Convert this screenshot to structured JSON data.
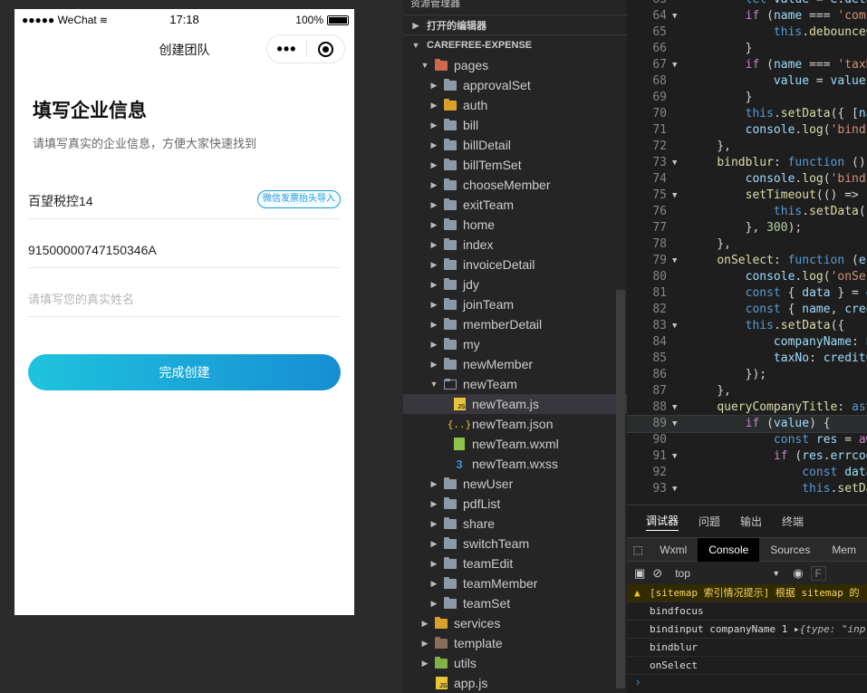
{
  "simulator": {
    "status": {
      "carrier": "●●●●● WeChat",
      "time": "17:18",
      "battery": "100%"
    },
    "nav_title": "创建团队",
    "heading": "填写企业信息",
    "subtitle": "请填写真实的企业信息，方便大家快速找到",
    "company_name": "百望税控14",
    "import_label": "微信发票抬头导入",
    "tax_no": "91500000747150346A",
    "name_placeholder": "请填写您的真实姓名",
    "submit_label": "完成创建"
  },
  "explorer": {
    "top_label": "资源管理器",
    "open_editors": "打开的编辑器",
    "project": "CAREFREE-EXPENSE",
    "tree": [
      {
        "label": "pages",
        "depth": 1,
        "type": "folder-red",
        "open": true
      },
      {
        "label": "approvalSet",
        "depth": 2,
        "type": "folder"
      },
      {
        "label": "auth",
        "depth": 2,
        "type": "folder-gold"
      },
      {
        "label": "bill",
        "depth": 2,
        "type": "folder"
      },
      {
        "label": "billDetail",
        "depth": 2,
        "type": "folder"
      },
      {
        "label": "billTemSet",
        "depth": 2,
        "type": "folder"
      },
      {
        "label": "chooseMember",
        "depth": 2,
        "type": "folder"
      },
      {
        "label": "exitTeam",
        "depth": 2,
        "type": "folder"
      },
      {
        "label": "home",
        "depth": 2,
        "type": "folder"
      },
      {
        "label": "index",
        "depth": 2,
        "type": "folder"
      },
      {
        "label": "invoiceDetail",
        "depth": 2,
        "type": "folder"
      },
      {
        "label": "jdy",
        "depth": 2,
        "type": "folder"
      },
      {
        "label": "joinTeam",
        "depth": 2,
        "type": "folder"
      },
      {
        "label": "memberDetail",
        "depth": 2,
        "type": "folder"
      },
      {
        "label": "my",
        "depth": 2,
        "type": "folder"
      },
      {
        "label": "newMember",
        "depth": 2,
        "type": "folder"
      },
      {
        "label": "newTeam",
        "depth": 2,
        "type": "folder-open",
        "open": true
      },
      {
        "label": "newTeam.js",
        "depth": 3,
        "type": "js",
        "selected": true
      },
      {
        "label": "newTeam.json",
        "depth": 3,
        "type": "json"
      },
      {
        "label": "newTeam.wxml",
        "depth": 3,
        "type": "wxml"
      },
      {
        "label": "newTeam.wxss",
        "depth": 3,
        "type": "wxss"
      },
      {
        "label": "newUser",
        "depth": 2,
        "type": "folder"
      },
      {
        "label": "pdfList",
        "depth": 2,
        "type": "folder"
      },
      {
        "label": "share",
        "depth": 2,
        "type": "folder"
      },
      {
        "label": "switchTeam",
        "depth": 2,
        "type": "folder"
      },
      {
        "label": "teamEdit",
        "depth": 2,
        "type": "folder"
      },
      {
        "label": "teamMember",
        "depth": 2,
        "type": "folder"
      },
      {
        "label": "teamSet",
        "depth": 2,
        "type": "folder"
      },
      {
        "label": "services",
        "depth": 1,
        "type": "folder-gold"
      },
      {
        "label": "template",
        "depth": 1,
        "type": "folder-brown"
      },
      {
        "label": "utils",
        "depth": 1,
        "type": "folder-green"
      },
      {
        "label": "app.js",
        "depth": 1,
        "type": "js"
      }
    ]
  },
  "editor": {
    "lines": [
      {
        "n": "63",
        "fold": "",
        "html": "        <span class='k'>let</span> <span class='v'>value</span> = <span class='v'>e</span>.<span class='v'>deta</span>"
      },
      {
        "n": "64",
        "fold": "v",
        "html": "        <span class='kw'>if</span> (<span class='v'>name</span> === <span class='s'>'comp</span>"
      },
      {
        "n": "65",
        "fold": "",
        "html": "            <span class='k'>this</span>.<span class='f'>debounceC</span>"
      },
      {
        "n": "66",
        "fold": "",
        "html": "        }"
      },
      {
        "n": "67",
        "fold": "v",
        "html": "        <span class='kw'>if</span> (<span class='v'>name</span> === <span class='s'>'taxN</span>"
      },
      {
        "n": "68",
        "fold": "",
        "html": "            <span class='v'>value</span> = <span class='v'>value</span>."
      },
      {
        "n": "69",
        "fold": "",
        "html": "        }"
      },
      {
        "n": "70",
        "fold": "",
        "html": "        <span class='k'>this</span>.<span class='f'>setData</span>({ [<span class='v'>na</span>"
      },
      {
        "n": "71",
        "fold": "",
        "html": "        <span class='v'>console</span>.<span class='f'>log</span>(<span class='s'>'bindi</span>"
      },
      {
        "n": "72",
        "fold": "",
        "html": "    },"
      },
      {
        "n": "73",
        "fold": "v",
        "html": "    <span class='f'>bindblur</span>: <span class='k'>function</span> () {"
      },
      {
        "n": "74",
        "fold": "",
        "html": "        <span class='v'>console</span>.<span class='f'>log</span>(<span class='s'>'bindb</span>"
      },
      {
        "n": "75",
        "fold": "v",
        "html": "        <span class='f'>setTimeout</span>(() => {"
      },
      {
        "n": "76",
        "fold": "",
        "html": "            <span class='k'>this</span>.<span class='f'>setData</span>({"
      },
      {
        "n": "77",
        "fold": "",
        "html": "        }, <span class='n'>300</span>);"
      },
      {
        "n": "78",
        "fold": "",
        "html": "    },"
      },
      {
        "n": "79",
        "fold": "v",
        "html": "    <span class='f'>onSelect</span>: <span class='k'>function</span> (<span class='v'>e</span>)"
      },
      {
        "n": "80",
        "fold": "",
        "html": "        <span class='v'>console</span>.<span class='f'>log</span>(<span class='s'>'onSel</span>"
      },
      {
        "n": "81",
        "fold": "",
        "html": "        <span class='k'>const</span> { <span class='v'>data</span> } = <span class='v'>e</span>"
      },
      {
        "n": "82",
        "fold": "",
        "html": "        <span class='k'>const</span> { <span class='v'>name</span>, <span class='v'>cred</span>"
      },
      {
        "n": "83",
        "fold": "v",
        "html": "        <span class='k'>this</span>.<span class='f'>setData</span>({"
      },
      {
        "n": "84",
        "fold": "",
        "html": "            <span class='v'>companyName</span>: <span class='v'>n</span>"
      },
      {
        "n": "85",
        "fold": "",
        "html": "            <span class='v'>taxNo</span>: <span class='v'>creditC</span>"
      },
      {
        "n": "86",
        "fold": "",
        "html": "        });"
      },
      {
        "n": "87",
        "fold": "",
        "html": "    },"
      },
      {
        "n": "88",
        "fold": "v",
        "html": "    <span class='f'>queryCompanyTitle</span>: <span class='k'>asy</span>"
      },
      {
        "n": "89",
        "fold": "v",
        "html": "        <span class='kw'>if</span> (<span class='v'>value</span>) {",
        "hl": true
      },
      {
        "n": "90",
        "fold": "",
        "html": "            <span class='k'>const</span> <span class='v'>res</span> = <span class='kw'>aw</span>"
      },
      {
        "n": "91",
        "fold": "v",
        "html": "            <span class='kw'>if</span> (<span class='v'>res</span>.<span class='v'>errcod</span>"
      },
      {
        "n": "92",
        "fold": "",
        "html": "                <span class='k'>const</span> <span class='v'>data</span>"
      },
      {
        "n": "93",
        "fold": "v",
        "html": "                <span class='k'>this</span>.<span class='f'>setDa</span>"
      }
    ]
  },
  "debug": {
    "tabs": [
      "调试器",
      "问题",
      "输出",
      "终端"
    ],
    "devtools_tabs": [
      "Wxml",
      "Console",
      "Sources",
      "Mem"
    ],
    "context": "top",
    "filter": "F",
    "logs": [
      {
        "kind": "warn",
        "text": "[sitemap 索引情况提示] 根据 sitemap 的"
      },
      {
        "kind": "log",
        "text": "bindfocus"
      },
      {
        "kind": "log",
        "text": "bindinput companyName 1 ▸",
        "obj": "{type: \"inp"
      },
      {
        "kind": "log",
        "text": "bindblur"
      },
      {
        "kind": "log",
        "text": "onSelect"
      }
    ],
    "prompt": "›"
  }
}
